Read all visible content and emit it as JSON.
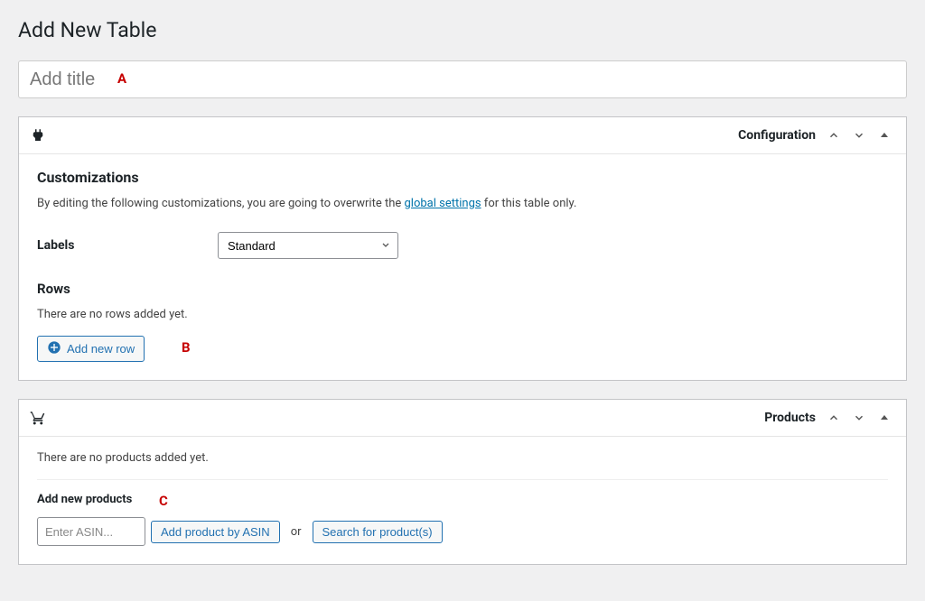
{
  "page_title": "Add New Table",
  "title_placeholder": "Add title",
  "annotations": {
    "a": "A",
    "b": "B",
    "c": "C"
  },
  "config_box": {
    "panel_title": "Configuration",
    "customizations_heading": "Customizations",
    "description_pre": "By editing the following customizations, you are going to overwrite the ",
    "description_link": "global settings",
    "description_post": " for this table only.",
    "labels_label": "Labels",
    "labels_value": "Standard",
    "rows_heading": "Rows",
    "rows_empty": "There are no rows added yet.",
    "add_row_label": "Add new row"
  },
  "products_box": {
    "panel_title": "Products",
    "empty_text": "There are no products added yet.",
    "add_new_heading": "Add new products",
    "asin_placeholder": "Enter ASIN...",
    "add_by_asin_label": "Add product by ASIN",
    "or_text": "or",
    "search_label": "Search for product(s)"
  }
}
